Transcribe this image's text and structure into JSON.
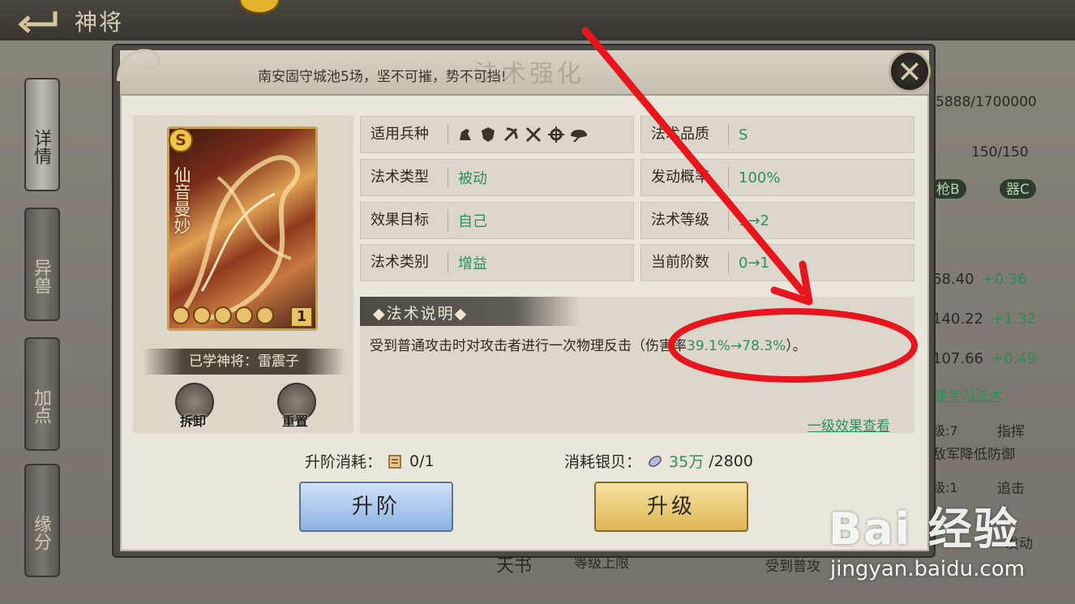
{
  "screen": {
    "title": "神将",
    "side_tabs": [
      "详情",
      "异兽",
      "加点",
      "缘分"
    ]
  },
  "background": {
    "progress_text": "5888/1700000",
    "count_text": "150/150",
    "chips": [
      "枪B",
      "器C"
    ],
    "stats": [
      {
        "value": "68.40",
        "delta": "+0.36"
      },
      {
        "value": "140.22",
        "delta": "+1.32"
      },
      {
        "value": "107.66",
        "delta": "+0.49"
      }
    ],
    "learn_link": "建学习法术",
    "skill_notes": [
      "级:7",
      "指挥",
      "敌军降低防御",
      "级:1",
      "追击",
      "发动"
    ],
    "bottom_text": "受到普攻",
    "bottom_labels": [
      "天书",
      "等级上限"
    ]
  },
  "dialog": {
    "header_quote": "南安固守城池5场，坚不可摧，势不可挡!",
    "header_watermark": "法术强化",
    "card": {
      "grade": "S",
      "name": "仙音曼妙",
      "level": "1",
      "star_count": 5,
      "learned_by": "已学神将：雷震子"
    },
    "actions": {
      "dismantle_label": "拆卸",
      "reset_label": "重置"
    },
    "attributes": {
      "troops": {
        "label": "适用兵种",
        "icons": [
          "cavalry-icon",
          "shield-icon",
          "bow-icon",
          "spear-icon",
          "crosshair-icon",
          "fan-icon"
        ]
      },
      "quality": {
        "label": "法术品质",
        "value": "S"
      },
      "type": {
        "label": "法术类型",
        "value": "被动"
      },
      "trigger_rate": {
        "label": "发动概率",
        "value": "100%"
      },
      "target": {
        "label": "效果目标",
        "value": "自己"
      },
      "spell_level": {
        "label": "法术等级",
        "value": "1→2"
      },
      "category": {
        "label": "法术类别",
        "value": "增益"
      },
      "current_rank": {
        "label": "当前阶数",
        "value": "0→1"
      }
    },
    "description": {
      "title": "法术说明",
      "text_prefix": "受到普通攻击时对攻击者进行一次物理反击（伤害率",
      "text_value": "39.1%→78.3%",
      "text_suffix": "）。",
      "level1_link": "一级效果查看"
    },
    "costs": {
      "advance_label": "升阶消耗：",
      "advance_value": "0/1",
      "silver_label": "消耗银贝：",
      "silver_have": "35万",
      "silver_need": "/2800"
    },
    "buttons": {
      "advance": "升阶",
      "upgrade": "升级"
    }
  },
  "watermark": {
    "main": "Bai 经验",
    "url": "jingyan.baidu.com"
  },
  "colors": {
    "green_value": "#2d8f5e",
    "annotation_red": "#e8141e",
    "advance_button": "#a9c6ec",
    "upgrade_button": "#e8c86f"
  }
}
